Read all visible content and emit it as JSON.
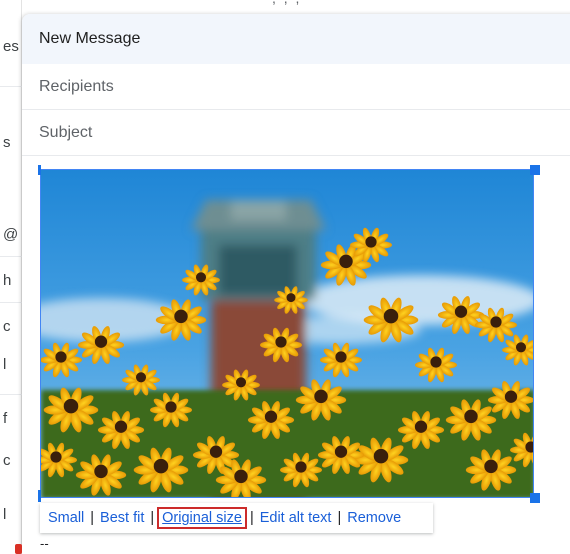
{
  "background": {
    "side_chars": [
      "es",
      "s",
      "@",
      "h",
      "c",
      "l",
      "f",
      "c",
      "l"
    ]
  },
  "compose": {
    "title": "New Message",
    "recipients_placeholder": "Recipients",
    "subject_placeholder": "Subject"
  },
  "image_toolbar": {
    "small": "Small",
    "best_fit": "Best fit",
    "original_size": "Original size",
    "edit_alt_text": "Edit alt text",
    "remove": "Remove",
    "separator": "|"
  },
  "body": {
    "signature_dashes": "--"
  },
  "colors": {
    "accent": "#1a73e8",
    "link": "#1a5fd8",
    "header_bg": "#f2f6fc",
    "highlight_box": "#cc2b2b"
  }
}
